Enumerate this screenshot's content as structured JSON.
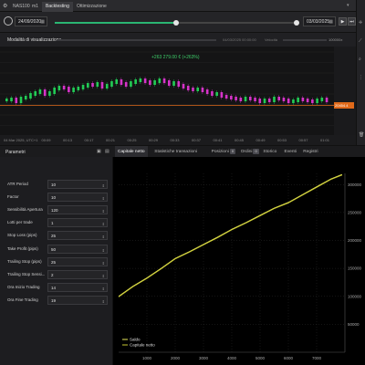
{
  "topbar": {
    "symbol_tab": "NAS100",
    "timeframe_tab": "m1",
    "backtesting_tab": "Backtesting",
    "optimization_tab": "Ottimizzazione"
  },
  "range": {
    "start_date": "24/09/2020",
    "end_date": "03/03/2025",
    "progress": 0.5
  },
  "modebar": {
    "label": "Modalità di visualizzazione",
    "timestamp": "04/03/2025 00:00:00",
    "mode_value": "Velocità",
    "speed_value": "100000x"
  },
  "chart": {
    "pnl_label": "+263 279.00 € (+263%)",
    "current_price": "20454.4",
    "y_ticks": [
      "20475",
      "20470",
      "20465",
      "20460",
      "20455",
      "20450",
      "20445",
      "20440"
    ],
    "x_ticks": [
      "04 Mar 2025, UTC+1",
      "00:09",
      "00:13",
      "00:17",
      "00:21",
      "00:25",
      "00:29",
      "00:33",
      "00:37",
      "00:41",
      "00:45",
      "00:49",
      "00:53",
      "00:57",
      "01:01"
    ],
    "up_color": "#22cc55",
    "down_color": "#d633c9",
    "price_line_color": "#e06a1a"
  },
  "params": {
    "title": "Parametri",
    "rows": [
      {
        "label": "ATR Period",
        "value": "10"
      },
      {
        "label": "Factor",
        "value": "10"
      },
      {
        "label": "Sensibilità Apertura",
        "value": "120"
      },
      {
        "label": "Lotti per trade",
        "value": "1"
      },
      {
        "label": "Stop Loss (pips)",
        "value": "25"
      },
      {
        "label": "Take Profit (pips)",
        "value": "50"
      },
      {
        "label": "Trailing Stop (pips)",
        "value": "25"
      },
      {
        "label": "Trailing Stop Sensi...",
        "value": "2"
      },
      {
        "label": "Ora Inizio Trading",
        "value": "14"
      },
      {
        "label": "Ora Fine Trading",
        "value": "19"
      }
    ]
  },
  "results": {
    "tabs": [
      {
        "label": "Capitale netto",
        "badge": ""
      },
      {
        "label": "Statistiche transazioni",
        "badge": ""
      },
      {
        "label": "Posizioni",
        "badge": "0"
      },
      {
        "label": "Ordini",
        "badge": "0"
      },
      {
        "label": "Storico",
        "badge": ""
      },
      {
        "label": "Eventi",
        "badge": ""
      },
      {
        "label": "Registri",
        "badge": ""
      }
    ]
  },
  "chart_data": {
    "type": "line",
    "title": "",
    "xlabel": "",
    "ylabel": "",
    "xlim": [
      0,
      8000
    ],
    "ylim": [
      0,
      320000
    ],
    "x_ticks": [
      "1000",
      "2000",
      "3000",
      "4000",
      "5000",
      "6000",
      "7000"
    ],
    "y_ticks": [
      "50000",
      "100000",
      "150000",
      "200000",
      "250000",
      "300000"
    ],
    "series": [
      {
        "name": "Saldo",
        "color": "#e8e85a",
        "x": [
          0,
          500,
          1000,
          1500,
          2000,
          2500,
          3000,
          3500,
          4000,
          4500,
          5000,
          5500,
          6000,
          6500,
          7000,
          7500,
          7900
        ],
        "y": [
          100000,
          118000,
          133000,
          150000,
          168000,
          180000,
          193000,
          206000,
          220000,
          232000,
          245000,
          258000,
          268000,
          282000,
          296000,
          310000,
          318000
        ]
      },
      {
        "name": "Capitale netto",
        "color": "#c8c832",
        "x": [
          0,
          500,
          1000,
          1500,
          2000,
          2500,
          3000,
          3500,
          4000,
          4500,
          5000,
          5500,
          6000,
          6500,
          7000,
          7500,
          7900
        ],
        "y": [
          100000,
          118000,
          133000,
          150000,
          168000,
          180000,
          193000,
          206000,
          220000,
          232000,
          245000,
          258000,
          268000,
          282000,
          296000,
          310000,
          318000
        ]
      }
    ],
    "legend": "bottom-left",
    "grid": true
  }
}
